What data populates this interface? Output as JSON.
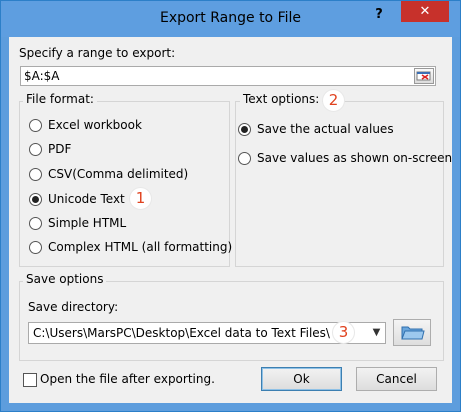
{
  "window": {
    "title": "Export Range to File",
    "help_label": "?",
    "close_label": "✕"
  },
  "range": {
    "label": "Specify a range to export:",
    "value": "$A:$A"
  },
  "file_format": {
    "legend": "File format:",
    "options": [
      {
        "label": "Excel workbook",
        "checked": false
      },
      {
        "label": "PDF",
        "checked": false
      },
      {
        "label": "CSV(Comma delimited)",
        "checked": false
      },
      {
        "label": "Unicode Text",
        "checked": true
      },
      {
        "label": "Simple HTML",
        "checked": false
      },
      {
        "label": "Complex HTML (all formatting)",
        "checked": false
      }
    ],
    "badge": "1"
  },
  "text_options": {
    "legend": "Text options:",
    "options": [
      {
        "label": "Save the actual values",
        "checked": true
      },
      {
        "label": "Save values as shown on-screen",
        "checked": false
      }
    ],
    "badge": "2"
  },
  "save_options": {
    "legend": "Save options",
    "directory_label": "Save directory:",
    "directory_value": "C:\\Users\\MarsPC\\Desktop\\Excel data to Text Files\\",
    "badge": "3"
  },
  "open_after": {
    "label": "Open the file after exporting.",
    "checked": false
  },
  "buttons": {
    "ok": "Ok",
    "cancel": "Cancel"
  },
  "icons": [
    "range-select-icon",
    "chevron-down-icon",
    "folder-icon"
  ]
}
